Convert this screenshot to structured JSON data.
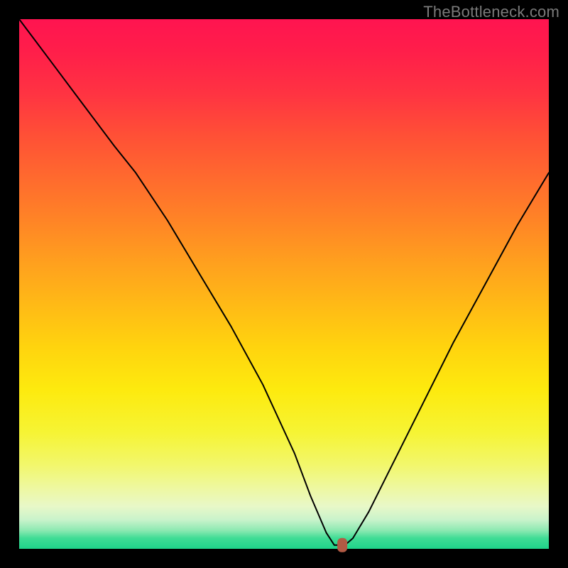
{
  "watermark": "TheBottleneck.com",
  "colors": {
    "frame": "#000000",
    "curve": "#000000",
    "marker": "#b25a44"
  },
  "chart_data": {
    "type": "line",
    "title": "",
    "xlabel": "",
    "ylabel": "",
    "xlim": [
      0,
      100
    ],
    "ylim": [
      0,
      100
    ],
    "grid": false,
    "legend": false,
    "annotations": [
      "TheBottleneck.com"
    ],
    "series": [
      {
        "name": "bottleneck-curve",
        "x": [
          0,
          6,
          12,
          18,
          22,
          28,
          34,
          40,
          46,
          52,
          55,
          58,
          59.5,
          61.5,
          63,
          66,
          70,
          76,
          82,
          88,
          94,
          100
        ],
        "y": [
          100,
          92,
          84,
          76,
          71,
          62,
          52,
          42,
          31,
          18,
          10,
          3,
          0.7,
          0.7,
          2,
          7,
          15,
          27,
          39,
          50,
          61,
          71
        ]
      }
    ],
    "marker": {
      "x": 61,
      "y": 0.7
    },
    "gradient_stops": [
      {
        "pos": 0,
        "color": "#ff1450"
      },
      {
        "pos": 0.5,
        "color": "#ffba16"
      },
      {
        "pos": 0.78,
        "color": "#f6f434"
      },
      {
        "pos": 0.94,
        "color": "#c9f3cb"
      },
      {
        "pos": 1.0,
        "color": "#1fd38a"
      }
    ]
  }
}
